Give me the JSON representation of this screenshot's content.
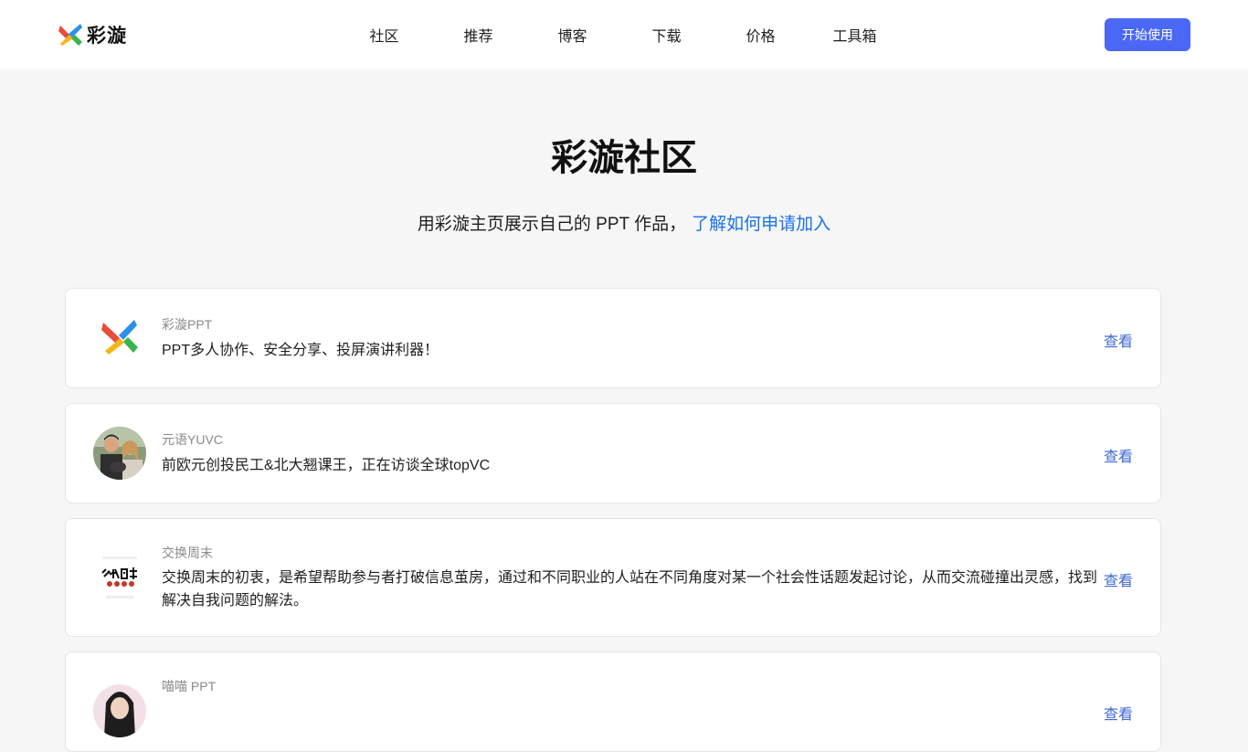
{
  "header": {
    "logo_text": "彩漩",
    "nav": [
      "社区",
      "推荐",
      "博客",
      "下载",
      "价格",
      "工具箱"
    ],
    "cta_label": "开始使用"
  },
  "hero": {
    "title": "彩漩社区",
    "subtitle": "用彩漩主页展示自己的 PPT 作品，",
    "link": "了解如何申请加入"
  },
  "cards": [
    {
      "name": "彩漩PPT",
      "desc": "PPT多人协作、安全分享、投屏演讲利器！",
      "view": "查看",
      "avatar_icon": "caixuan-logo-icon"
    },
    {
      "name": "元语YUVC",
      "desc": "前欧元创投民工&北大翘课王，正在访谈全球topVC",
      "view": "查看",
      "avatar_icon": "people-photo-avatar"
    },
    {
      "name": "交换周末",
      "desc": "交换周末的初衷，是希望帮助参与者打破信息茧房，通过和不同职业的人站在不同角度对某一个社会性话题发起讨论，从而交流碰撞出灵感，找到解决自我问题的解法。",
      "view": "查看",
      "avatar_icon": "weekend-calligraphy-avatar"
    },
    {
      "name": "喵喵 PPT",
      "desc": "",
      "view": "查看",
      "avatar_icon": "person-photo-avatar"
    }
  ],
  "colors": {
    "accent": "#4a68f5",
    "link": "#1a73e8",
    "view_link": "#3f67d6",
    "background": "#f6f6f7"
  }
}
